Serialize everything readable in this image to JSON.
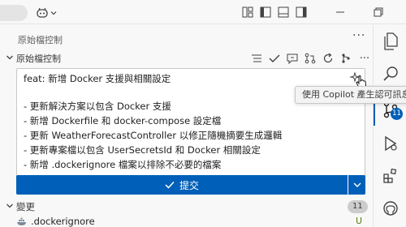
{
  "panel": {
    "title": "原始檔控制",
    "more": "···"
  },
  "section": {
    "title": "原始檔控制",
    "more": "···"
  },
  "commit_message": {
    "lines": [
      "feat: 新增 Docker 支援與相關設定",
      "",
      "- 更新解決方案以包含 Docker 支援",
      "- 新增 Dockerfile 和 docker-compose 設定檔",
      "- 更新 WeatherForecastController 以修正隨機摘要生成邏輯",
      "- 更新專案檔以包含 UserSecretsId 和 Docker 相關設定",
      "- 新增 .dockerignore 檔案以排除不必要的檔案"
    ]
  },
  "tooltip": "使用 Copilot 產生認可訊息",
  "commit_button": {
    "label": "提交"
  },
  "changes": {
    "title": "變更",
    "count": "11",
    "files": [
      {
        "name": ".dockerignore",
        "status": "U"
      }
    ]
  },
  "activity_bar": {
    "scm_badge": "11"
  },
  "colors": {
    "accent": "#005fb8",
    "untracked": "#587c0c"
  }
}
